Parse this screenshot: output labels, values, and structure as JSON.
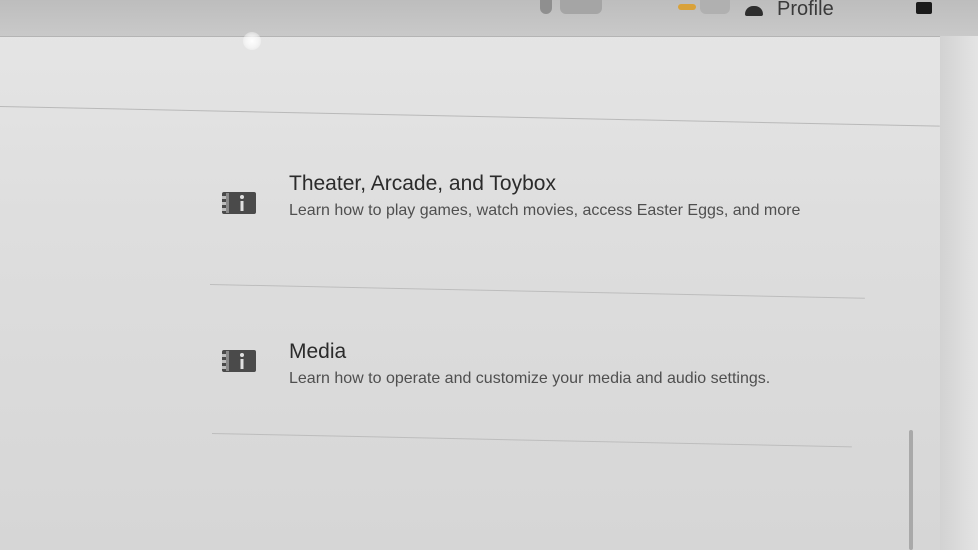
{
  "topbar": {
    "profile_label": "Profile"
  },
  "items": [
    {
      "title": "Theater, Arcade, and Toybox",
      "description": "Learn how to play games, watch movies, access Easter Eggs, and more",
      "icon": "manual-book-icon"
    },
    {
      "title": "Media",
      "description": "Learn how to operate and customize your media and audio settings.",
      "icon": "manual-book-icon"
    }
  ],
  "colors": {
    "background": "#dcdcdc",
    "title_text": "#2b2b2b",
    "description_text": "#4f4f4f",
    "divider": "#bdbdbd",
    "accent_topbar_item": "#d9a23a"
  }
}
